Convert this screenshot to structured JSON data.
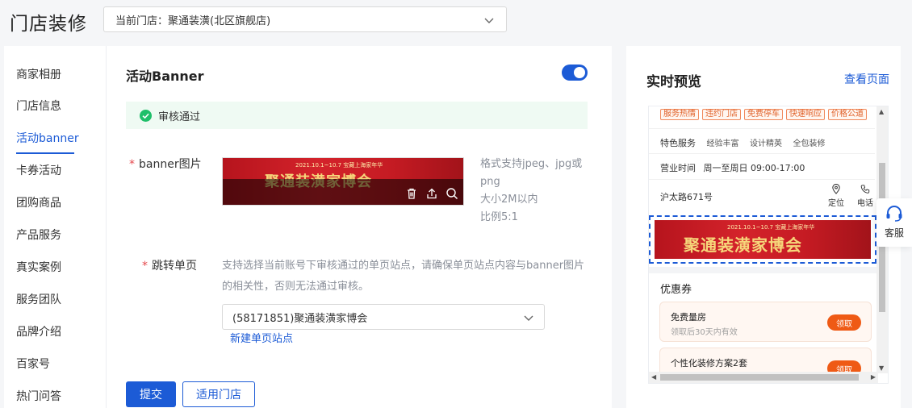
{
  "header": {
    "title": "门店装修",
    "store_select": "当前门店：聚通装潢(北区旗舰店)"
  },
  "sidebar": {
    "items": [
      {
        "label": "商家相册"
      },
      {
        "label": "门店信息"
      },
      {
        "label": "活动banner",
        "active": true
      },
      {
        "label": "卡券活动"
      },
      {
        "label": "团购商品"
      },
      {
        "label": "产品服务"
      },
      {
        "label": "真实案例"
      },
      {
        "label": "服务团队"
      },
      {
        "label": "品牌介绍"
      },
      {
        "label": "百家号"
      },
      {
        "label": "热门问答"
      }
    ]
  },
  "main": {
    "section_title": "活动Banner",
    "toggle_on": true,
    "status_text": "审核通过",
    "banner_label": "banner图片",
    "banner_image": {
      "ribbon": "2021.10.1~10.7  宝藏上海家年华",
      "headline": "聚通装潢家博会"
    },
    "banner_hint": [
      "格式支持jpeg、jpg或",
      "png",
      "大小2M以内",
      "比例5:1"
    ],
    "jump_label": "跳转单页",
    "jump_desc": "支持选择当前账号下审核通过的单页站点，请确保单页站点内容与banner图片的相关性，否则无法通过审核。",
    "page_select": "(58171851)聚通装潢家博会",
    "new_page_link": "新建单页站点",
    "submit_label": "提交",
    "apply_store_label": "适用门店"
  },
  "preview": {
    "title": "实时预览",
    "view_page": "查看页面",
    "tags": [
      "服务热情",
      "违约门店",
      "免费停车",
      "快速响应",
      "价格公道"
    ],
    "feature_label": "特色服务",
    "features": [
      "经验丰富",
      "设计精英",
      "全包装修"
    ],
    "hours_label": "营业时间",
    "hours": "周一至周日 09:00-17:00",
    "address": "沪太路671号",
    "locate_label": "定位",
    "phone_label": "电话",
    "coupon_section": "优惠券",
    "coupons": [
      {
        "name": "免费量房",
        "desc": "领取后30天内有效",
        "btn": "领取"
      },
      {
        "name": "个性化装修方案2套",
        "desc": "",
        "btn": "领取"
      }
    ]
  },
  "float_service": {
    "label": "客服"
  },
  "colors": {
    "accent": "#1c5bd6",
    "success": "#1fbf6a",
    "coupon_btn": "#ef5a15"
  }
}
